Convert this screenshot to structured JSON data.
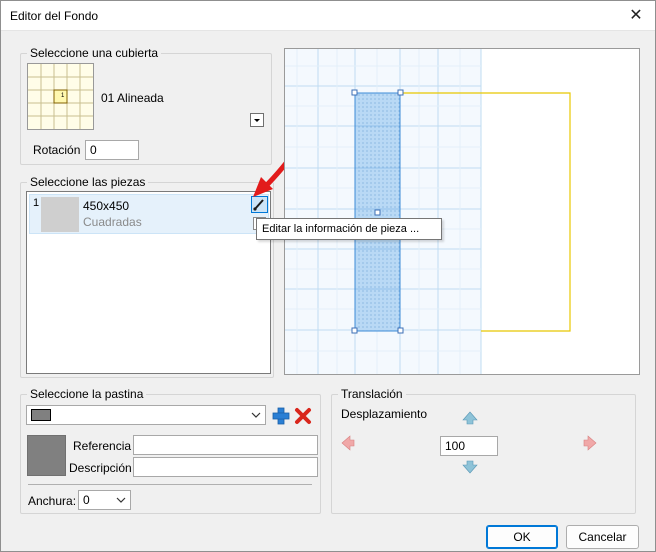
{
  "window": {
    "title": "Editor del Fondo",
    "close_glyph": "✕"
  },
  "cover": {
    "group_label": "Seleccione una cubierta",
    "selected_name": "01 Alineada",
    "thumbnail_number": "1",
    "rotation_label": "Rotación",
    "rotation_value": "0"
  },
  "pieces": {
    "group_label": "Seleccione las piezas",
    "items": [
      {
        "index": "1",
        "name": "450x450",
        "type": "Cuadradas",
        "swatch_color": "#cfcfcf"
      }
    ],
    "edit_tooltip": "Editar la información de pieza ..."
  },
  "grout": {
    "group_label": "Seleccione la pastina",
    "swatch_color": "#808080",
    "reference_label": "Referencia",
    "reference_value": "",
    "description_label": "Descripción",
    "description_value": "",
    "width_label": "Anchura:",
    "width_value": "0",
    "add_icon": "plus-icon",
    "delete_icon": "delete-x-icon"
  },
  "translation": {
    "group_label": "Translación",
    "offset_label": "Desplazamiento",
    "offset_value": "100"
  },
  "buttons": {
    "ok": "OK",
    "cancel": "Cancelar"
  },
  "colors": {
    "accent": "#0078d7",
    "piece_fill": "#b9d9f5",
    "cover_outline": "#e8c800",
    "annotation_arrow": "#e21b1b",
    "delete_red": "#d9261c",
    "add_blue": "#2a7fd4"
  }
}
